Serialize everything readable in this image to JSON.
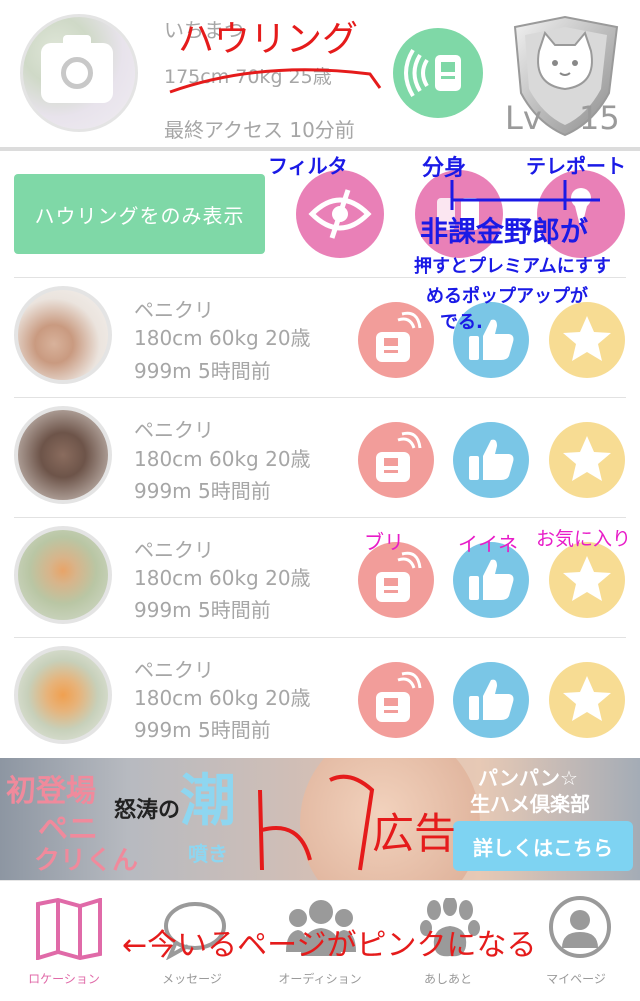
{
  "header": {
    "user_name": "いちまつ",
    "user_stats": "175cm 70kg 25歳",
    "last_access": "最終アクセス 10分前",
    "level_prefix": "Lv",
    "level_number": "15"
  },
  "filter": {
    "howl_only_label": "ハウリングをのみ表示"
  },
  "users": [
    {
      "name": "ペニクリ",
      "stats": "180cm 60kg 20歳",
      "meta": "999m 5時間前"
    },
    {
      "name": "ペニクリ",
      "stats": "180cm 60kg 20歳",
      "meta": "999m 5時間前"
    },
    {
      "name": "ペニクリ",
      "stats": "180cm 60kg 20歳",
      "meta": "999m 5時間前"
    },
    {
      "name": "ペニクリ",
      "stats": "180cm 60kg 20歳",
      "meta": "999m 5時間前"
    }
  ],
  "ad": {
    "line1": "初登場",
    "line2": "ペニ",
    "line3": "クリくん",
    "middle": "怒涛の",
    "big": "潮",
    "sub": "噴き",
    "right_line1": "パンパン☆",
    "right_line2": "生ハメ倶楽部",
    "button": "詳しくはこちら"
  },
  "nav": [
    {
      "label": "ロケーション",
      "icon": "map-icon",
      "active": true
    },
    {
      "label": "メッセージ",
      "icon": "speech-bubble-icon",
      "active": false
    },
    {
      "label": "オーディション",
      "icon": "group-icon",
      "active": false
    },
    {
      "label": "あしあと",
      "icon": "paw-icon",
      "active": false
    },
    {
      "label": "マイページ",
      "icon": "person-icon",
      "active": false
    }
  ],
  "annotations": {
    "howling": "ハウリング",
    "filter": "フィルタ",
    "clone": "分身",
    "teleport": "テレポート",
    "non_paying_1": "非課金野郎が",
    "non_paying_2": "押すとプレミアムにすす",
    "non_paying_3": "めるポップアップが",
    "non_paying_4": "でる.",
    "buri": "ブリ",
    "like": "イイネ",
    "favorite": "お気に入り",
    "ad": "広告",
    "current_page": "←今いるページがピンクになる"
  },
  "colors": {
    "green": "#7fd8a7",
    "pink": "#e980b7",
    "red_action": "#f29d9a",
    "blue_action": "#7ac6e6",
    "yellow_action": "#f7dc93",
    "active_nav": "#e06aa8",
    "inactive_nav": "#9a9a9a"
  }
}
